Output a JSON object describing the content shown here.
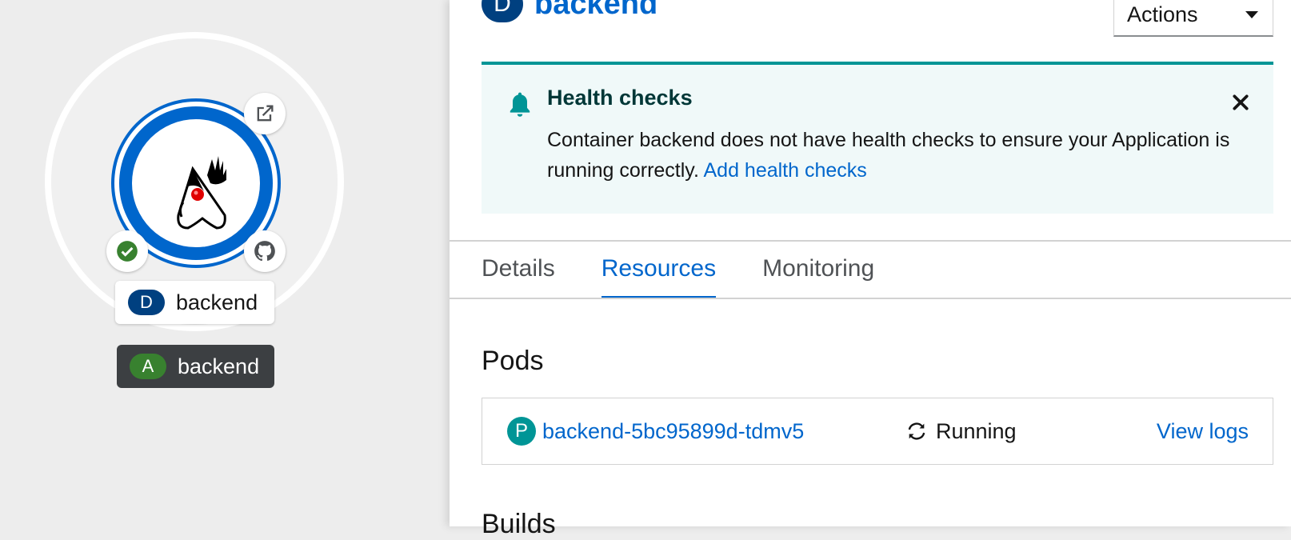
{
  "topology": {
    "node": {
      "label_badge": "D",
      "label": "backend"
    },
    "application": {
      "badge": "A",
      "label": "backend"
    },
    "status_color": "#38812f",
    "accent": "#0066cc"
  },
  "panel": {
    "header_badge": "D",
    "title": "backend",
    "actions_label": "Actions",
    "alert": {
      "title": "Health checks",
      "body": "Container backend does not have health checks to ensure your Application is running correctly.",
      "link": "Add health checks"
    },
    "tabs": [
      {
        "label": "Details",
        "active": false
      },
      {
        "label": "Resources",
        "active": true
      },
      {
        "label": "Monitoring",
        "active": false
      }
    ],
    "pods_section_title": "Pods",
    "pod": {
      "badge": "P",
      "name": "backend-5bc95899d-tdmv5",
      "status": "Running",
      "logs_link": "View logs"
    },
    "next_section_title": "Builds"
  }
}
